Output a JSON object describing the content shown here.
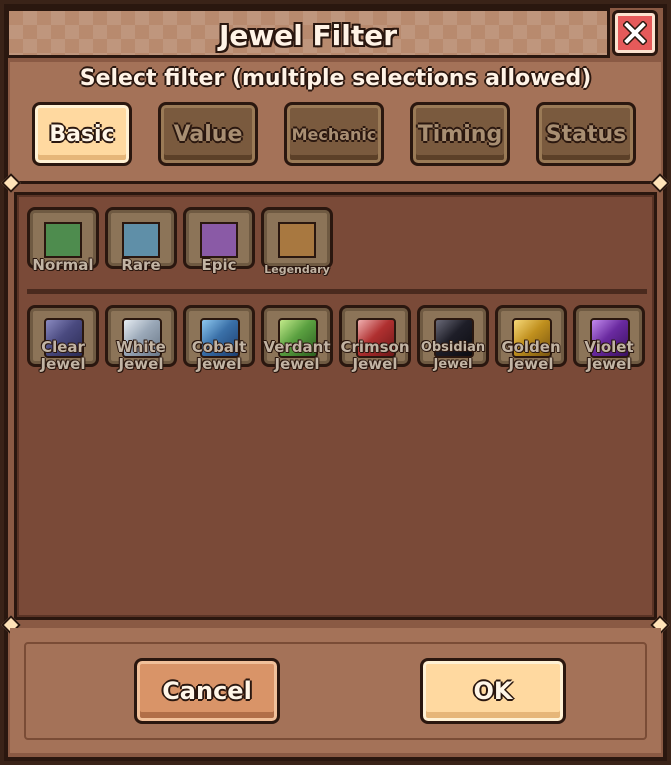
{
  "dialog": {
    "title": "Jewel Filter",
    "close_icon": "close-icon",
    "subtitle": "Select filter (multiple selections allowed)"
  },
  "tabs": [
    {
      "label": "Basic",
      "active": true
    },
    {
      "label": "Value",
      "active": false
    },
    {
      "label": "Mechanic",
      "active": false
    },
    {
      "label": "Timing",
      "active": false
    },
    {
      "label": "Status",
      "active": false
    }
  ],
  "rarities": [
    {
      "label": "Normal",
      "color": "#4e8c4e"
    },
    {
      "label": "Rare",
      "color": "#5f8fa8"
    },
    {
      "label": "Epic",
      "color": "#8a5aa6"
    },
    {
      "label": "Legendary",
      "color": "#a87840"
    }
  ],
  "jewels": [
    {
      "label": "Clear Jewel",
      "color": "#4a4a80"
    },
    {
      "label": "White Jewel",
      "color": "#9aa8b8"
    },
    {
      "label": "Cobalt Jewel",
      "color": "#3a70a8"
    },
    {
      "label": "Verdant Jewel",
      "color": "#5aa040"
    },
    {
      "label": "Crimson Jewel",
      "color": "#b03030"
    },
    {
      "label": "Obsidian Jewel",
      "color": "#1e1e28"
    },
    {
      "label": "Golden Jewel",
      "color": "#c0901e"
    },
    {
      "label": "Violet Jewel",
      "color": "#6a2aa0"
    }
  ],
  "footer": {
    "cancel_label": "Cancel",
    "ok_label": "OK"
  }
}
